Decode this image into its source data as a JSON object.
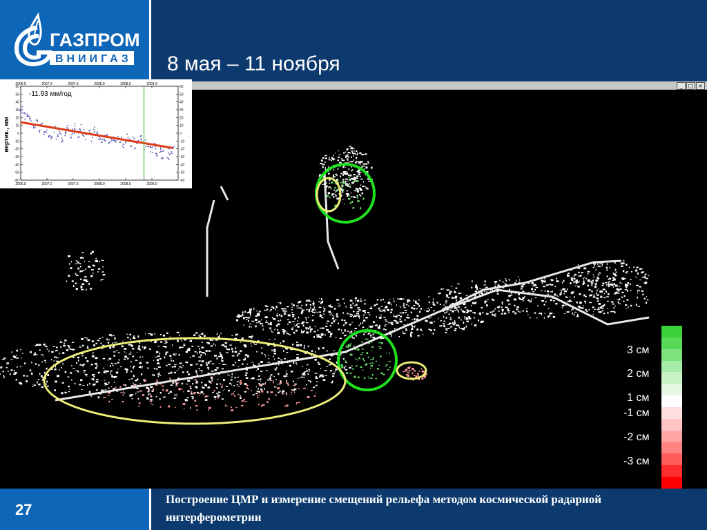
{
  "logo": {
    "brand": "ГАЗПРОМ",
    "sub": "ВНИИГАЗ",
    "color": "#0e66b8"
  },
  "slide": {
    "title": "8 мая – 11 ноября",
    "page_number": "27",
    "footer_text": "Построение ЦМР и измерение смещений рельефа  методом космической радарной интерферометрии"
  },
  "window_controls": {
    "icons": [
      "minimize-icon",
      "maximize-icon",
      "close-icon"
    ],
    "glyphs": [
      "_",
      "□",
      "×"
    ]
  },
  "legend": {
    "labels": [
      "3 см",
      "2 см",
      "1 см",
      "-1 см",
      "-2 см",
      "-3 см"
    ],
    "colors": [
      "#3ad13a",
      "#58da58",
      "#7fe27f",
      "#a6eca6",
      "#c7f3c7",
      "#e4f9e4",
      "#ffffff",
      "#ffe0e0",
      "#ffc4c4",
      "#ffa6a6",
      "#ff8484",
      "#ff5c5c",
      "#ff2e2e",
      "#ff0000"
    ]
  },
  "highlights": {
    "green_color": "#1ee01e",
    "yellow_color": "#eded7a"
  },
  "chart_data": {
    "type": "scatter",
    "title": "",
    "annotation": "-11.93 мм/год",
    "ylabel": "вертик., мм",
    "xlabel": "",
    "x_ticks": [
      "2006.5",
      "2007.0",
      "2007.5",
      "2008.0",
      "2008.5",
      "2009.0"
    ],
    "y_ticks": [
      "60",
      "50",
      "40",
      "30",
      "20",
      "10",
      "0",
      "-10",
      "-20",
      "-30",
      "-40",
      "-50",
      "-60"
    ],
    "xlim": [
      2006.5,
      2009.5
    ],
    "ylim": [
      -60,
      60
    ],
    "trend": {
      "x": [
        2006.5,
        2009.4
      ],
      "y": [
        14,
        -19
      ],
      "color": "#e03a1a"
    },
    "vertical_marker": {
      "x": 2008.85,
      "color": "#22aa22"
    },
    "points_color": "#4a4aa8",
    "series": [
      {
        "x": [
          2006.5,
          2006.55,
          2006.6,
          2006.65,
          2006.7,
          2006.75,
          2006.8,
          2006.85,
          2006.9,
          2006.95,
          2007.0,
          2007.05,
          2007.1,
          2007.15,
          2007.2,
          2007.25,
          2007.3,
          2007.35,
          2007.4,
          2007.45,
          2007.5,
          2007.55,
          2007.6,
          2007.65,
          2007.7,
          2007.75,
          2007.8,
          2007.85,
          2007.9,
          2007.95,
          2008.0,
          2008.05,
          2008.1,
          2008.15,
          2008.2,
          2008.25,
          2008.3,
          2008.35,
          2008.4,
          2008.45,
          2008.5,
          2008.55,
          2008.6,
          2008.65,
          2008.7,
          2008.75,
          2008.8,
          2008.85,
          2008.9,
          2008.95,
          2009.0,
          2009.05,
          2009.1,
          2009.15,
          2009.2,
          2009.25,
          2009.3,
          2009.35,
          2009.4
        ],
        "y": [
          25,
          30,
          22,
          18,
          15,
          8,
          12,
          6,
          10,
          2,
          5,
          0,
          -3,
          4,
          -5,
          2,
          -8,
          0,
          5,
          -2,
          3,
          8,
          -1,
          6,
          0,
          -4,
          2,
          -6,
          4,
          -2,
          -3,
          -8,
          -5,
          1,
          -10,
          -6,
          -12,
          -4,
          -8,
          -14,
          -10,
          -6,
          -12,
          -9,
          -15,
          -11,
          -8,
          -16,
          -13,
          -18,
          -22,
          -15,
          -25,
          -20,
          -28,
          -18,
          -30,
          -24,
          -21
        ]
      }
    ]
  }
}
